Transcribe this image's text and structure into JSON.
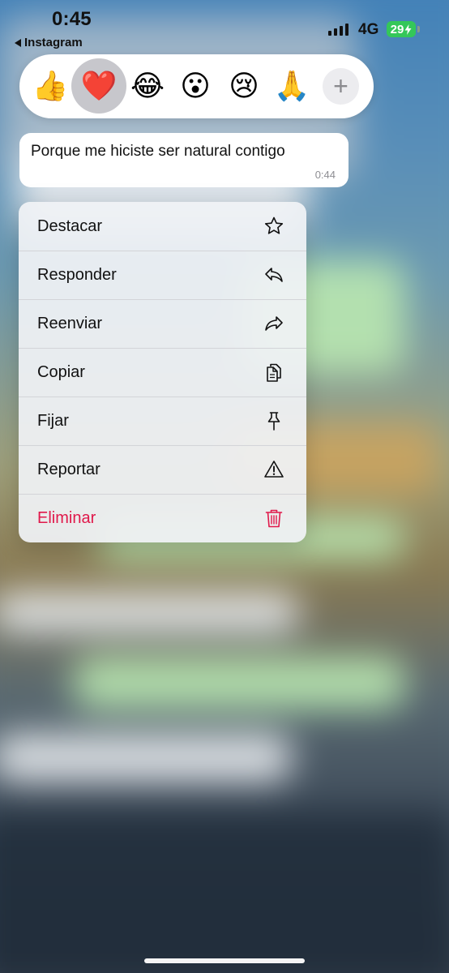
{
  "status_bar": {
    "time": "0:45",
    "back_app": "Instagram",
    "network": "4G",
    "battery": "29"
  },
  "reactions": {
    "items": [
      {
        "name": "thumbs-up",
        "glyph": "👍",
        "selected": false
      },
      {
        "name": "red-heart",
        "glyph": "❤️",
        "selected": true
      },
      {
        "name": "tears-of-joy",
        "glyph": "😂",
        "selected": false
      },
      {
        "name": "surprised",
        "glyph": "😮",
        "selected": false
      },
      {
        "name": "crying",
        "glyph": "😢",
        "selected": false
      },
      {
        "name": "folded-hands",
        "glyph": "🙏",
        "selected": false
      }
    ],
    "more_label": "+"
  },
  "message": {
    "text": "Porque me hiciste ser natural contigo",
    "time": "0:44"
  },
  "menu": {
    "items": [
      {
        "label": "Destacar",
        "icon": "star-icon"
      },
      {
        "label": "Responder",
        "icon": "reply-icon"
      },
      {
        "label": "Reenviar",
        "icon": "forward-icon"
      },
      {
        "label": "Copiar",
        "icon": "copy-icon"
      },
      {
        "label": "Fijar",
        "icon": "pin-icon"
      },
      {
        "label": "Reportar",
        "icon": "warning-icon"
      },
      {
        "label": "Eliminar",
        "icon": "trash-icon",
        "danger": true
      }
    ]
  },
  "colors": {
    "danger": "#e0184a",
    "battery": "#34c759",
    "selected_reaction_bg": "#c7c7cc"
  }
}
